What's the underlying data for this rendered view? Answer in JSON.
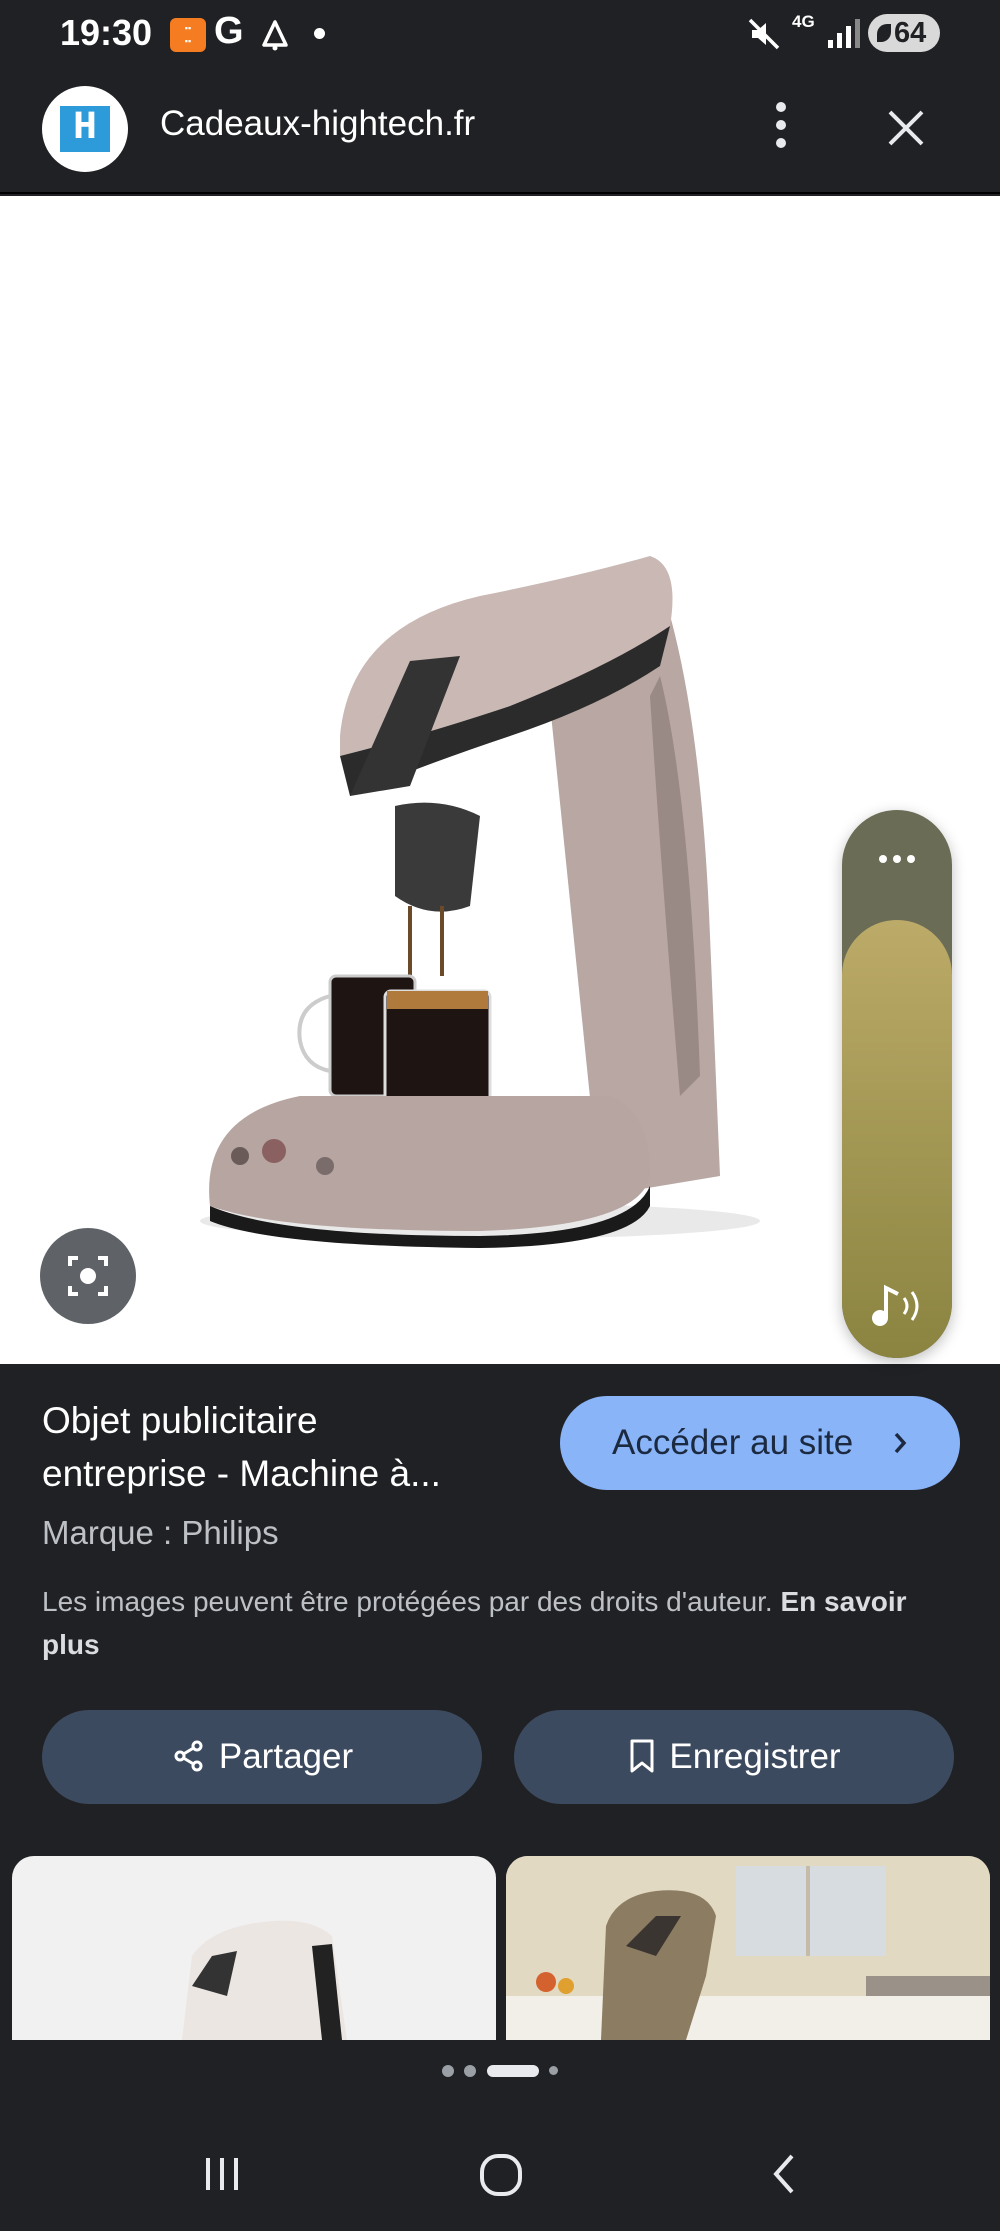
{
  "status_bar": {
    "time": "19:30",
    "network": "4G",
    "battery": "64"
  },
  "header": {
    "site_name": "Cadeaux-hightech.fr",
    "favicon_letter": "H"
  },
  "image": {
    "subject": "coffee-machine",
    "sound_panel_level": 0.8
  },
  "result": {
    "title_line1": "Objet publicitaire",
    "title_line2": "entreprise - Machine à...",
    "visit_label": "Accéder au site",
    "brand": "Marque : Philips",
    "copyright": "Les images peuvent être protégées par des droits d'auteur.",
    "learn_more": "En savoir plus"
  },
  "actions": {
    "share_label": "Partager",
    "save_label": "Enregistrer"
  },
  "pager": {
    "total": 4,
    "current": 3
  },
  "colors": {
    "background": "#202124",
    "accent_button": "#8ab4f8",
    "action_button": "#3c4a5f",
    "sound_panel": "#6b6c56",
    "sound_fill": "#bcaa68"
  },
  "icons": [
    "search-icon",
    "more-vertical-icon",
    "close-icon",
    "lens-icon",
    "music-note-icon",
    "share-icon",
    "bookmark-icon",
    "recent-apps-icon",
    "home-icon",
    "back-icon"
  ]
}
